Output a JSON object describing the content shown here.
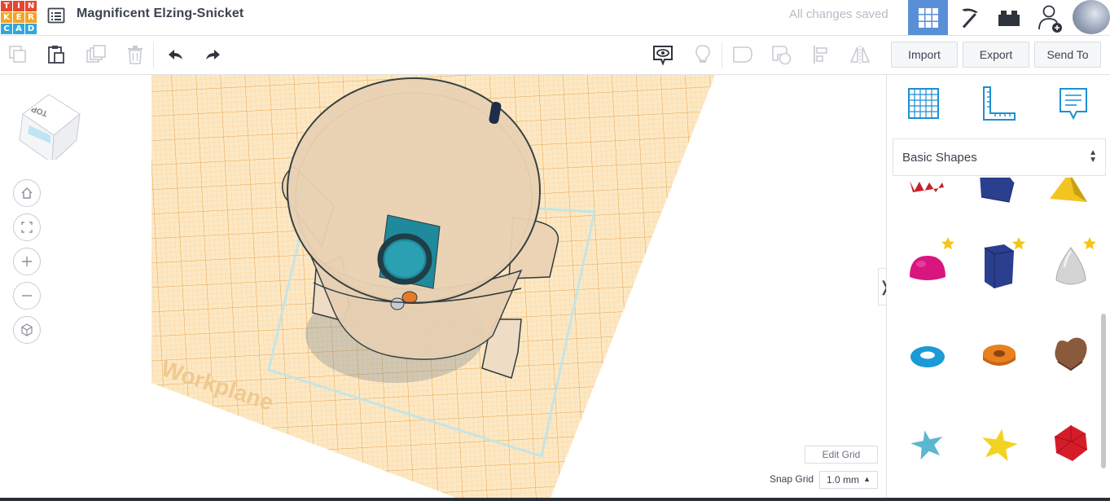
{
  "app": {
    "logo_letters": [
      "T",
      "I",
      "N",
      "K",
      "E",
      "R",
      "C",
      "A",
      "D"
    ],
    "logo_colors": [
      "#e6462f",
      "#e6462f",
      "#e6462f",
      "#f5a524",
      "#f5a524",
      "#f5a524",
      "#2ea7df",
      "#2ea7df",
      "#2ea7df"
    ],
    "menu_icon": "list-menu-icon",
    "document_title": "Magnificent Elzing-Snicket",
    "save_status": "All changes saved",
    "views": [
      {
        "name": "3d-design-view",
        "icon": "grid-icon",
        "active": true
      },
      {
        "name": "blocks-view",
        "icon": "pickaxe-icon",
        "active": false
      },
      {
        "name": "bricks-view",
        "icon": "brick-icon",
        "active": false
      }
    ],
    "accent_color": "#5a8fd8"
  },
  "toolbar": {
    "left_tools": [
      {
        "name": "copy-icon"
      },
      {
        "name": "paste-icon"
      },
      {
        "name": "duplicate-icon"
      },
      {
        "name": "delete-icon"
      },
      {
        "name": "undo-icon"
      },
      {
        "name": "redo-icon"
      }
    ],
    "right_tools": [
      {
        "name": "notes-visibility-icon"
      },
      {
        "name": "lightbulb-icon"
      },
      {
        "name": "group-icon"
      },
      {
        "name": "ungroup-icon"
      },
      {
        "name": "align-icon"
      },
      {
        "name": "mirror-icon"
      }
    ],
    "import_label": "Import",
    "export_label": "Export",
    "send_to_label": "Send To"
  },
  "workspace": {
    "view_cube_top": "TOP",
    "view_cube_front": "FRONT",
    "nav_buttons": [
      "home-view-icon",
      "fit-all-icon",
      "zoom-in-icon",
      "zoom-out-icon",
      "perspective-icon"
    ],
    "workplane_label": "Workplane",
    "edit_grid_label": "Edit Grid",
    "snap_grid_label": "Snap Grid",
    "snap_grid_value": "1.0 mm"
  },
  "panel": {
    "top_icons": [
      "workplane-icon",
      "ruler-icon",
      "notes-icon"
    ],
    "category": "Basic Shapes",
    "shapes": [
      {
        "name": "text-shape",
        "color": "#c8202a",
        "favorite": false
      },
      {
        "name": "polygon-shape",
        "color": "#2b3f8f",
        "favorite": false
      },
      {
        "name": "pyramid-shape",
        "color": "#f2c521",
        "favorite": false
      },
      {
        "name": "half-sphere-shape",
        "color": "#d9157f",
        "favorite": true
      },
      {
        "name": "hexagonal-prism-shape",
        "color": "#2b3f8f",
        "favorite": true
      },
      {
        "name": "paraboloid-shape",
        "color": "#d4d4d4",
        "favorite": true
      },
      {
        "name": "torus-shape",
        "color": "#1a9ad6",
        "favorite": false
      },
      {
        "name": "tube-shape",
        "color": "#e8801e",
        "favorite": false
      },
      {
        "name": "heart-shape",
        "color": "#8a5a3c",
        "favorite": false
      },
      {
        "name": "star-shape",
        "color": "#5bb6d0",
        "favorite": false
      },
      {
        "name": "star-yellow-shape",
        "color": "#f2d321",
        "favorite": false
      },
      {
        "name": "icosahedron-shape",
        "color": "#d51d2a",
        "favorite": false
      }
    ],
    "star_color": "#f5c518"
  }
}
